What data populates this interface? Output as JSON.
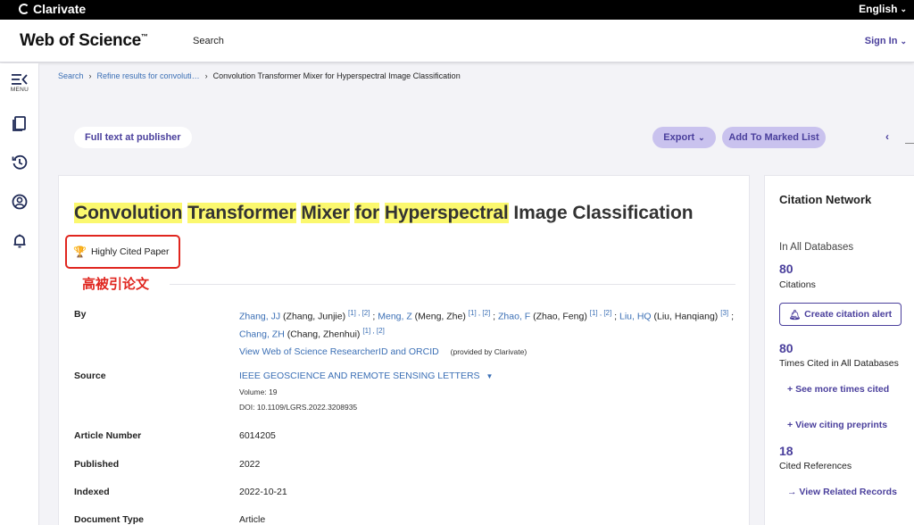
{
  "topbar": {
    "brand": "Clarivate",
    "language": "English"
  },
  "header": {
    "logo": "Web of Science",
    "logo_tm": "™",
    "nav_search": "Search",
    "signin": "Sign In"
  },
  "sidebar": {
    "menu_label": "MENU"
  },
  "breadcrumb": {
    "items": [
      "Search",
      "Refine results for convoluti…",
      "Convolution Transformer Mixer for Hyperspectral Image Classification"
    ]
  },
  "actions": {
    "full_text": "Full text at publisher",
    "export": "Export",
    "add_marked": "Add To Marked List"
  },
  "record": {
    "title_words": [
      "Convolution",
      "Transformer",
      "Mixer",
      "for",
      "Hyperspectral",
      "Image Classification"
    ],
    "highly_cited": "Highly Cited Paper",
    "annotation": "高被引论文",
    "by_label": "By",
    "authors": [
      {
        "short": "Zhang, JJ",
        "full": "(Zhang, Junjie)",
        "affil": "[1] , [2]"
      },
      {
        "short": "Meng, Z",
        "full": "(Meng, Zhe)",
        "affil": "[1] , [2]"
      },
      {
        "short": "Zhao, F",
        "full": "(Zhao, Feng)",
        "affil": "[1] , [2]"
      },
      {
        "short": "Liu, HQ",
        "full": "(Liu, Hanqiang)",
        "affil": "[3]"
      },
      {
        "short": "Chang, ZH",
        "full": "(Chang, Zhenhui)",
        "affil": "[1] , [2]"
      }
    ],
    "researcher_link": "View Web of Science ResearcherID and ORCID",
    "provided_by": "(provided by Clarivate)",
    "source_label": "Source",
    "source": "IEEE GEOSCIENCE AND REMOTE SENSING LETTERS",
    "volume": "Volume: 19",
    "doi": "DOI: 10.1109/LGRS.2022.3208935",
    "article_number_label": "Article Number",
    "article_number": "6014205",
    "published_label": "Published",
    "published": "2022",
    "indexed_label": "Indexed",
    "indexed": "2022-10-21",
    "doctype_label": "Document Type",
    "doctype": "Article"
  },
  "citation_network": {
    "title": "Citation Network",
    "subtitle": "In All Databases",
    "citations_count": "80",
    "citations_label": "Citations",
    "create_alert": "Create citation alert",
    "times_cited_count": "80",
    "times_cited_label": "Times Cited in All Databases",
    "see_more": "See more times cited",
    "view_preprints": "View citing preprints",
    "cited_refs_count": "18",
    "cited_refs_label": "Cited References",
    "view_related": "View Related Records"
  },
  "colors": {
    "accent": "#4a3f9c",
    "link": "#3b6fb5",
    "highlight": "#fbf86e",
    "annotation_red": "#e0261f"
  }
}
